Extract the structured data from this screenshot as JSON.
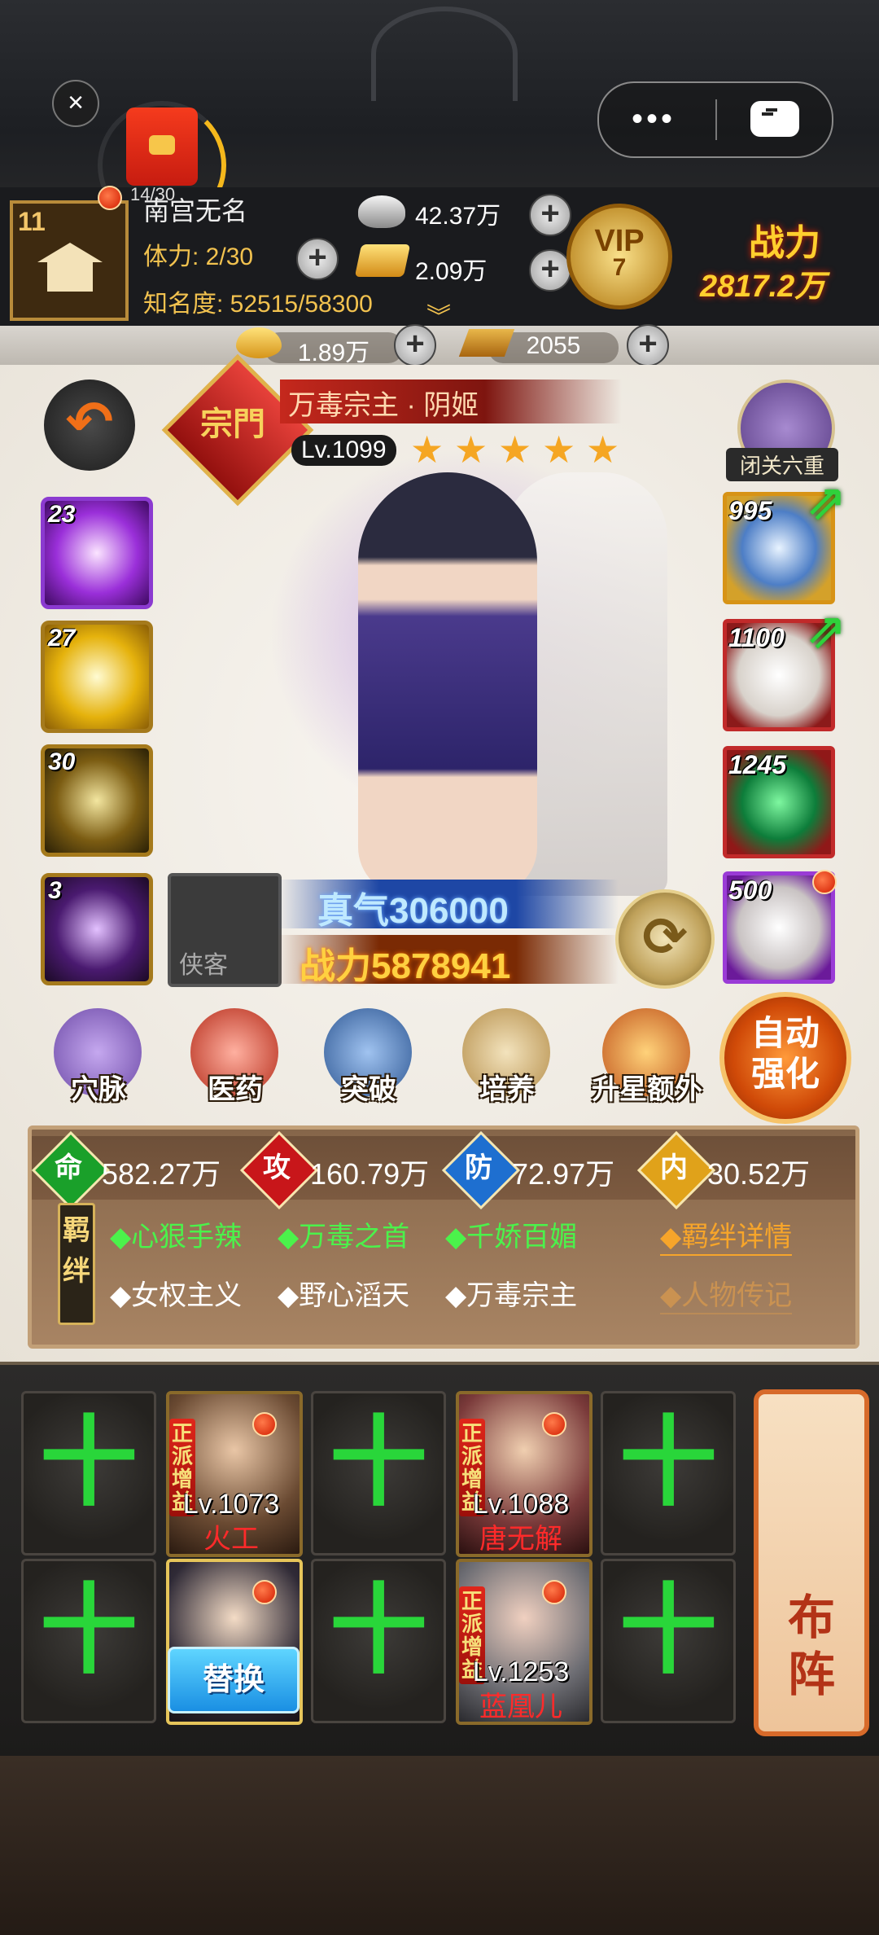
{
  "top": {
    "close": "×",
    "more_dots": "•••",
    "red_envelope_count": "14/30"
  },
  "player": {
    "level": "11",
    "name": "南宫无名",
    "stamina": "体力: 2/30",
    "fame": "知名度: 52515/58300",
    "silver": "42.37万",
    "gold": "2.09万",
    "vip_label": "VIP",
    "vip_level": "7",
    "power_label": "战力",
    "power_value": "2817.2万",
    "ingot": "1.89万",
    "gold_bar": "2055"
  },
  "hero": {
    "sect": "宗門",
    "name": "万毒宗主 · 阴姬",
    "level": "Lv.1099",
    "stars": 5,
    "seclusion": "闭关六重",
    "qi": "真气306000",
    "combat_power": "战力5878941",
    "companion_slot": "侠客"
  },
  "skills": [
    {
      "level": "23"
    },
    {
      "level": "27"
    },
    {
      "level": "30"
    },
    {
      "level": "3"
    }
  ],
  "equipment": [
    {
      "level": "995"
    },
    {
      "level": "1100"
    },
    {
      "level": "1245"
    },
    {
      "level": "500"
    }
  ],
  "menu": [
    {
      "label": "穴脉"
    },
    {
      "label": "医药"
    },
    {
      "label": "突破"
    },
    {
      "label": "培养"
    },
    {
      "label": "升星额外"
    }
  ],
  "auto_enhance": [
    "自动",
    "强化"
  ],
  "attributes": [
    {
      "icon": "命",
      "value": "582.27万",
      "color": "#1aa02a"
    },
    {
      "icon": "攻",
      "value": "160.79万",
      "color": "#c8161a"
    },
    {
      "icon": "防",
      "value": "72.97万",
      "color": "#1e6fd0"
    },
    {
      "icon": "内",
      "value": "30.52万",
      "color": "#e0a21a"
    }
  ],
  "bonds": {
    "tag": [
      "羁",
      "绊"
    ],
    "active": [
      "◆心狠手辣",
      "◆万毒之首",
      "◆千娇百媚"
    ],
    "inactive": [
      "◆女权主义",
      "◆野心滔天",
      "◆万毒宗主"
    ],
    "detail_link": "◆羁绊详情",
    "bio_link": "◆人物传记"
  },
  "lineup": {
    "slot_plus": "十",
    "tag": [
      "正",
      "派",
      "增",
      "益"
    ],
    "heroes": [
      {
        "level": "Lv.1073",
        "name": "火工"
      },
      {
        "level": "Lv.1088",
        "name": "唐无解"
      },
      {
        "level": "Lv.1253",
        "name": "蓝凰儿"
      }
    ],
    "replace": "替换",
    "formation": [
      "布",
      "阵"
    ]
  }
}
